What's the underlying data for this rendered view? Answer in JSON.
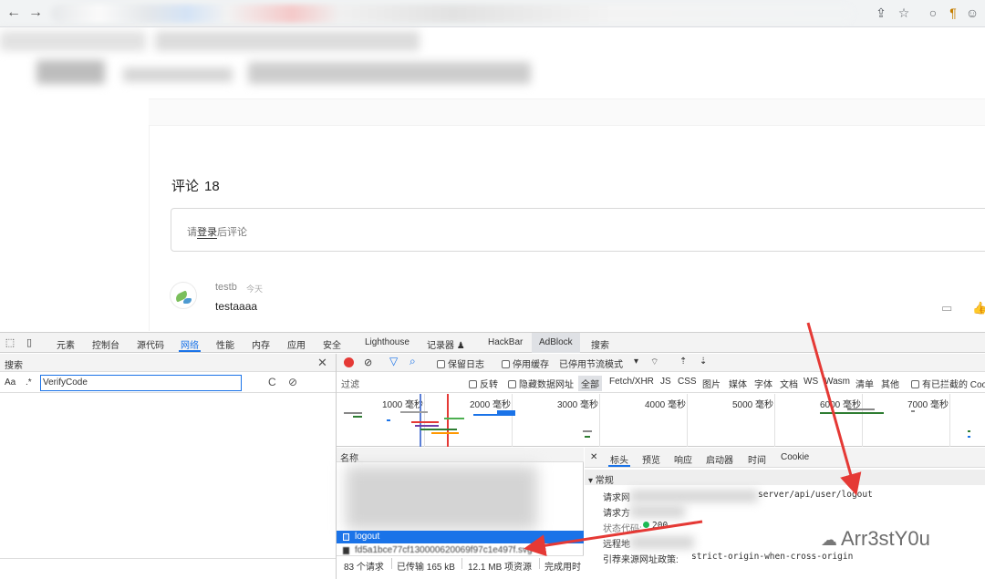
{
  "browser": {
    "back_icon": "←",
    "forward_icon": "→",
    "share_icon": "⇪",
    "star_icon": "☆",
    "ext1_icon": "○",
    "ext2_icon": "¶",
    "ext3_icon": "☺"
  },
  "page": {
    "comments_label": "评论",
    "comments_count": "18",
    "comment_placeholder_prefix": "请",
    "comment_placeholder_link": "登录",
    "comment_placeholder_suffix": "后评论",
    "comment": {
      "user": "testb",
      "time": "今天",
      "text": "testaaaa"
    },
    "reply_icon": "▭",
    "like_icon": "👍"
  },
  "devtools": {
    "tabs": [
      "元素",
      "控制台",
      "源代码",
      "网络",
      "性能",
      "内存",
      "应用",
      "安全",
      "Lighthouse",
      "记录器 ♟",
      "HackBar",
      "AdBlock",
      "搜索"
    ],
    "active_tab": "网络",
    "search": {
      "title": "搜索",
      "match_case": "Aa",
      "regex": ".*",
      "query": "VerifyCode",
      "close": "✕",
      "refresh": "C",
      "clear": "⊘"
    },
    "toolbar": {
      "preserve_log": "保留日志",
      "disable_cache": "停用缓存",
      "throttling": "已停用节流模式",
      "throttle_arrow": "▾",
      "upload": "⇡",
      "download": "⇣"
    },
    "filter": {
      "placeholder": "过滤",
      "invert": "反转",
      "hide_data_urls": "隐藏数据网址",
      "types": [
        "全部",
        "Fetch/XHR",
        "JS",
        "CSS",
        "图片",
        "媒体",
        "字体",
        "文档",
        "WS",
        "Wasm",
        "清单",
        "其他"
      ],
      "blocked_cookies": "有已拦截的 Coo"
    },
    "overview_ticks": [
      "1000 毫秒",
      "2000 毫秒",
      "3000 毫秒",
      "4000 毫秒",
      "5000 毫秒",
      "6000 毫秒",
      "7000 毫秒"
    ],
    "requests": {
      "header": "名称",
      "selected": "logout",
      "next": "fd5a1bce77cf130000620069f97c1e497f.svg"
    },
    "details": {
      "close": "✕",
      "tabs": [
        "标头",
        "预览",
        "响应",
        "启动器",
        "时间",
        "Cookie"
      ],
      "active_tab": "标头",
      "section": "▾ 常规",
      "request_url_label": "请求网",
      "request_url_value": "server/api/user/logout",
      "request_method_label": "请求方",
      "status_code_label": "状态代码:",
      "status_code_value": "200",
      "remote_address_label": "远程地",
      "referrer_policy_label": "引荐来源网址政策:",
      "referrer_policy_value": "strict-origin-when-cross-origin"
    },
    "status_bar": {
      "requests": "83 个请求",
      "transferred": "已传输 165 kB",
      "resources": "12.1 MB 项资源",
      "finished": "完成用时"
    }
  },
  "watermark": {
    "icon": "☁",
    "text": "Arr3stY0u"
  },
  "colors": {
    "accent": "#1a73e8",
    "record": "#e53935",
    "arrow": "#e53935",
    "status_ok": "#1db954"
  }
}
